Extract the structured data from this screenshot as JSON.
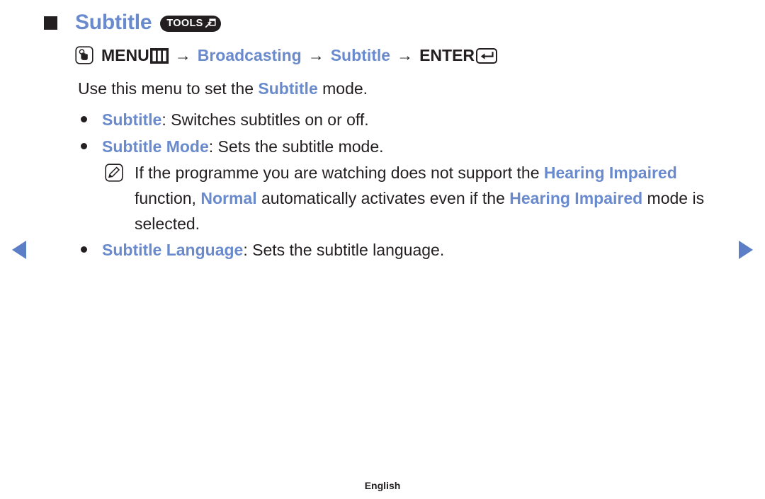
{
  "heading": {
    "bullet_icon": "square-bullet-icon",
    "title": "Subtitle",
    "tools_badge": {
      "label": "TOOLS",
      "icon": "tools-shortcut-icon"
    }
  },
  "menu_path": {
    "press_icon": "press-button-hand-icon",
    "menu_label": "MENU",
    "menu_icon": "menu-bars-icon",
    "arrow": "→",
    "step_broadcasting": "Broadcasting",
    "step_subtitle": "Subtitle",
    "enter_label": "ENTER",
    "enter_icon": "enter-return-icon"
  },
  "intro": {
    "before": "Use this menu to set the ",
    "highlight": "Subtitle",
    "after": " mode."
  },
  "bullets": [
    {
      "icon": "round-bullet-icon",
      "term": "Subtitle",
      "description": ": Switches subtitles on or off."
    },
    {
      "icon": "round-bullet-icon",
      "term": "Subtitle Mode",
      "description": ": Sets the subtitle mode."
    }
  ],
  "note": {
    "icon": "note-pencil-icon",
    "segments": [
      {
        "text": "If the programme you are watching does not support the ",
        "highlight": false
      },
      {
        "text": "Hearing Impaired",
        "highlight": true
      },
      {
        "text": " function, ",
        "highlight": false
      },
      {
        "text": "Normal",
        "highlight": true
      },
      {
        "text": " automatically activates even if the ",
        "highlight": false
      },
      {
        "text": "Hearing Impaired",
        "highlight": true
      },
      {
        "text": " mode is selected.",
        "highlight": false
      }
    ]
  },
  "bullets_after_note": [
    {
      "icon": "round-bullet-icon",
      "term": "Subtitle Language",
      "description": ": Sets the subtitle language."
    }
  ],
  "navigation": {
    "prev_icon": "previous-page-arrow-icon",
    "next_icon": "next-page-arrow-icon"
  },
  "footer": {
    "language": "English"
  },
  "colors": {
    "accent_blue": "#6a8ace",
    "arrow_blue": "#5b7ec6",
    "text_black": "#231f20",
    "badge_black": "#231f20",
    "background": "#ffffff"
  }
}
